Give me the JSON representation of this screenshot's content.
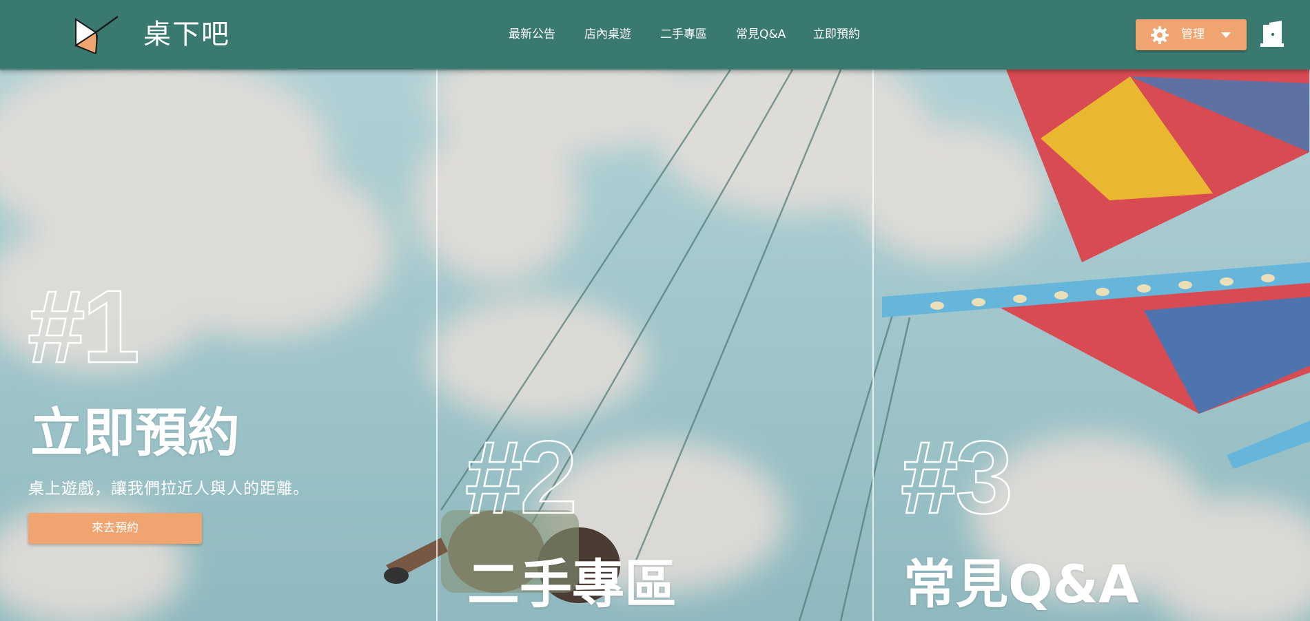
{
  "brand": {
    "name": "桌下吧",
    "logo_icon": "ticket-flag-logo"
  },
  "nav": {
    "items": [
      {
        "label": "最新公告"
      },
      {
        "label": "店內桌遊"
      },
      {
        "label": "二手專區"
      },
      {
        "label": "常見Q&A"
      },
      {
        "label": "立即預約"
      }
    ]
  },
  "admin": {
    "label": "管理",
    "icon": "gear-icon",
    "dropdown_icon": "caret-down-icon"
  },
  "logout_icon": "door-exit-icon",
  "panels": [
    {
      "number": "#1",
      "title": "立即預約",
      "subtitle": "桌上遊戲，讓我們拉近人與人的距離。",
      "button_label": "來去預約"
    },
    {
      "number": "#2",
      "title": "二手專區"
    },
    {
      "number": "#3",
      "title": "常見Q&A"
    }
  ],
  "colors": {
    "header_bg": "#3a796f",
    "accent": "#f0a470",
    "text_light": "#ffffff",
    "sky": "#8fb9c0"
  }
}
